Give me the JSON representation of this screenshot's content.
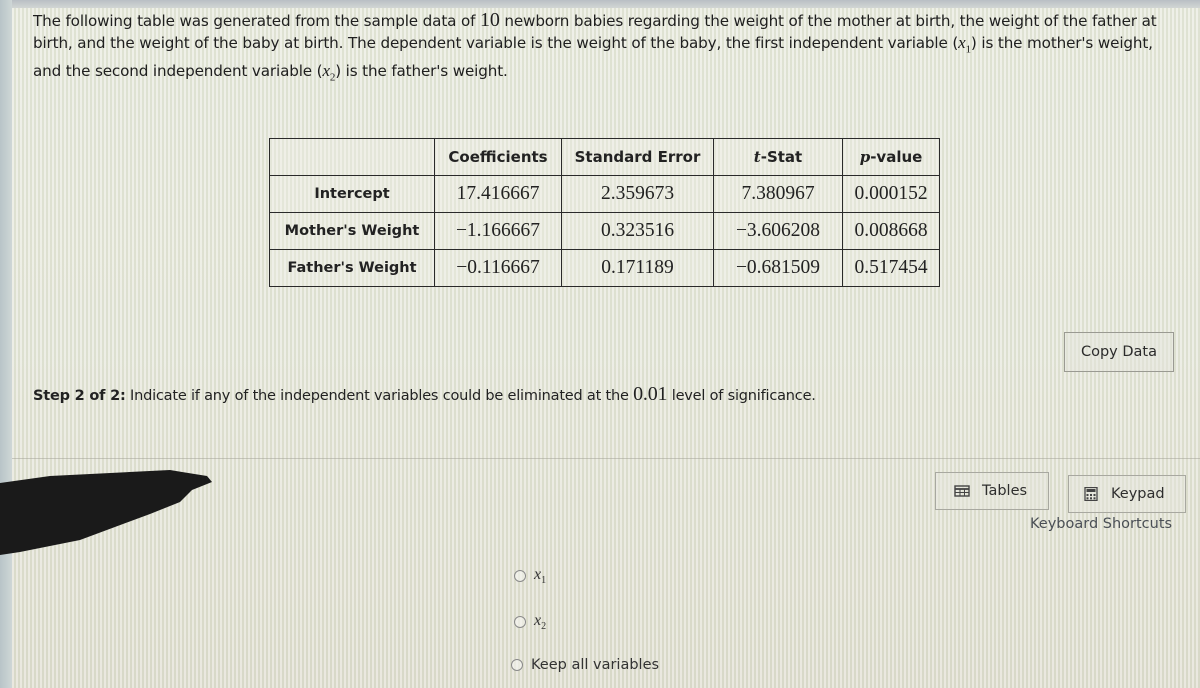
{
  "problem": {
    "intro_part1": "The following table was generated from the sample data of ",
    "sample_size": "10",
    "intro_part2": " newborn babies regarding the weight of the mother at birth, the weight of the father at birth, and the weight of the baby at birth. The dependent variable is the weight of the baby, the first independent variable (",
    "x1_symbol": "x",
    "x1_sub": "1",
    "intro_part3": ") is the mother's weight, and the second independent variable (",
    "x2_symbol": "x",
    "x2_sub": "2",
    "intro_part4": ") is the father's weight."
  },
  "table": {
    "headers": {
      "blank": "",
      "coefficients": "Coefficients",
      "standard_error": "Standard Error",
      "t_stat_italic": "t",
      "t_stat_rest": "-Stat",
      "p_value_italic": "p",
      "p_value_rest": "-value"
    },
    "rows": [
      {
        "label": "Intercept",
        "coefficient": "17.416667",
        "standard_error": "2.359673",
        "t_stat": "7.380967",
        "p_value": "0.000152"
      },
      {
        "label": "Mother's Weight",
        "coefficient": "−1.166667",
        "standard_error": "0.323516",
        "t_stat": "−3.606208",
        "p_value": "0.008668"
      },
      {
        "label": "Father's Weight",
        "coefficient": "−0.116667",
        "standard_error": "0.171189",
        "t_stat": "−0.681509",
        "p_value": "0.517454"
      }
    ]
  },
  "copy_data_button": "Copy Data",
  "step": {
    "label": "Step 2 of 2:",
    "text_part1": " Indicate if any of the independent variables could be eliminated at the ",
    "significance": "0.01",
    "text_part2": " level of significance."
  },
  "options": [
    {
      "symbol": "x",
      "sub": "1",
      "selected": false
    },
    {
      "symbol": "x",
      "sub": "2",
      "selected": false
    },
    {
      "label": "Keep all variables",
      "selected": false
    }
  ],
  "tools": {
    "tables_label": "Tables",
    "tables_icon": "table-icon",
    "keypad_label": "Keypad",
    "keypad_icon": "calculator-icon",
    "shortcuts_label": "Keyboard Shortcuts"
  }
}
